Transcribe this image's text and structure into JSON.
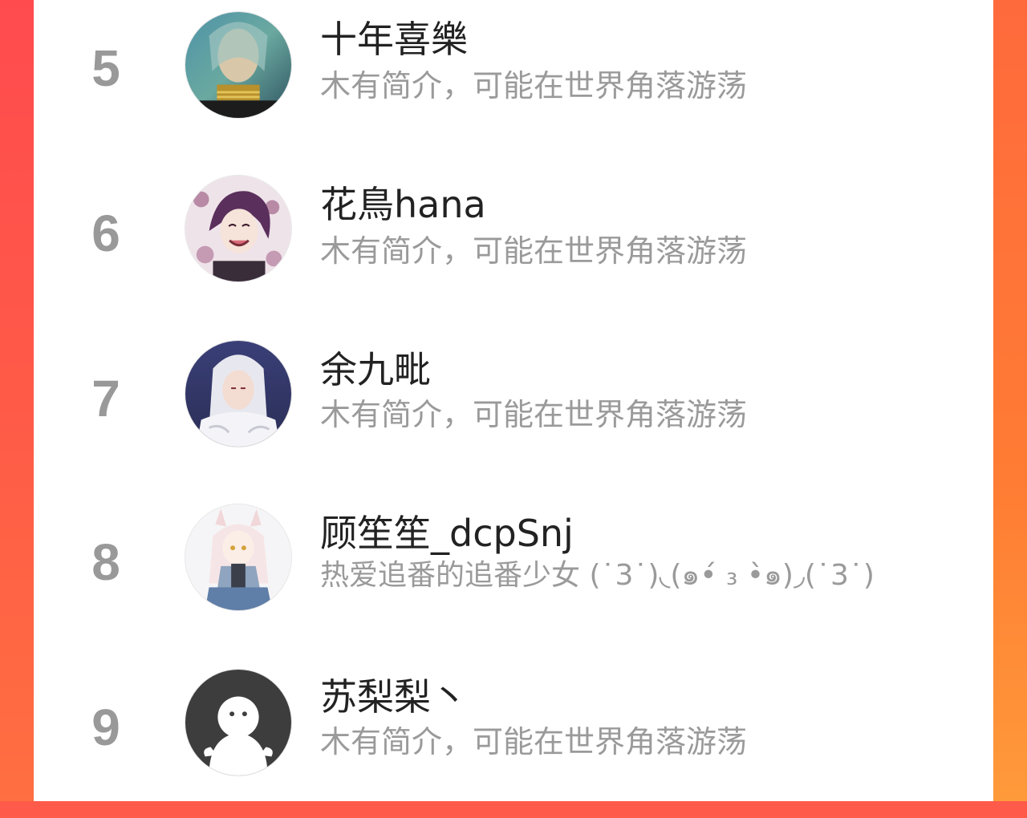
{
  "ranking": {
    "items": [
      {
        "rank": "5",
        "name": "十年喜樂",
        "bio": "木有简介，可能在世界角落游荡",
        "avatar_icon": "avatar-portrait-icon"
      },
      {
        "rank": "6",
        "name": "花鳥hana",
        "bio": "木有简介，可能在世界角落游荡",
        "avatar_icon": "avatar-anime-character-icon"
      },
      {
        "rank": "7",
        "name": "余九毗",
        "bio": "木有简介，可能在世界角落游荡",
        "avatar_icon": "avatar-anime-character-icon"
      },
      {
        "rank": "8",
        "name": "顾笙笙_dcpSnj",
        "bio": "热爱追番的追番少女 (˙3˙)◟(๑•́ ₃ •̀๑)◞(˙3˙)",
        "avatar_icon": "avatar-anime-girl-icon"
      },
      {
        "rank": "9",
        "name": "苏梨梨丶",
        "bio": "木有简介，可能在世界角落游荡",
        "avatar_icon": "default-avatar-icon"
      }
    ]
  },
  "colors": {
    "accent_left": "#ff4b4e",
    "accent_right": "#ff7c34",
    "rank_gray": "#999999",
    "name_text": "#222222",
    "bio_text": "#9a9a9a"
  }
}
